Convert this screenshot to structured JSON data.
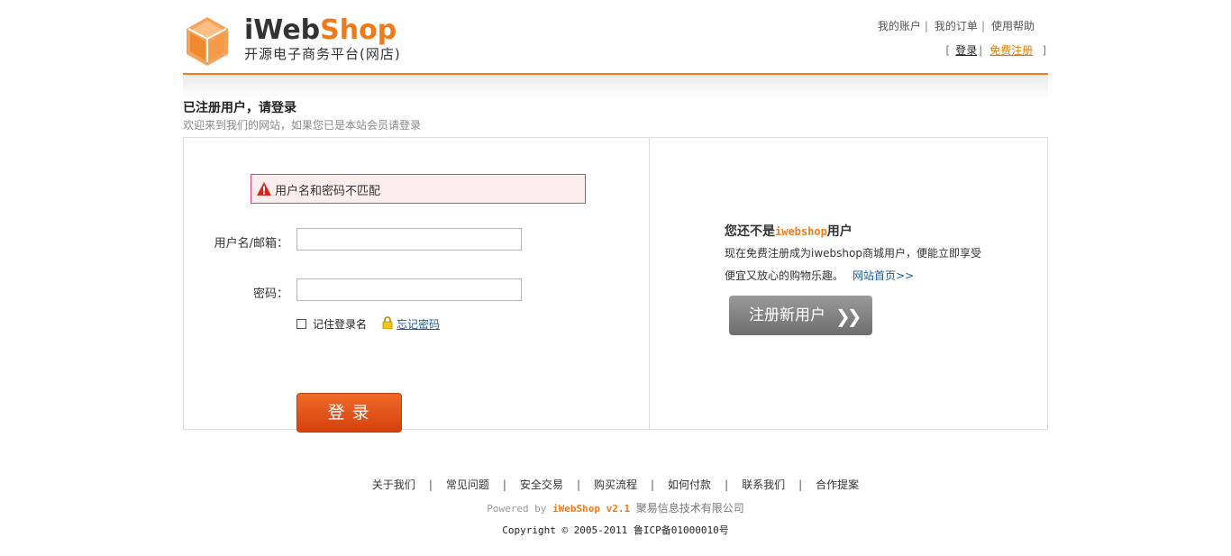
{
  "header": {
    "logo_title_i": "i",
    "logo_title_web": "Web",
    "logo_title_shop": "Shop",
    "logo_subtitle": "开源电子商务平台(网店)",
    "nav": [
      "我的账户",
      "我的订单",
      "使用帮助"
    ],
    "auth": {
      "open_bracket": "[",
      "login": "登录",
      "register": "免费注册",
      "close_bracket": "]"
    },
    "accent_color": "#f07a1a"
  },
  "page": {
    "title": "已注册用户，请登录",
    "subtitle": "欢迎来到我们的网站，如果您已是本站会员请登录"
  },
  "login_form": {
    "error_icon": "warning-icon",
    "error_message": "用户名和密码不匹配",
    "username_label": "用户名/邮箱：",
    "username_value": "",
    "password_label": "密码：",
    "password_value": "",
    "remember_label": "记住登录名",
    "remember_checked": false,
    "forgot_icon": "lock-icon",
    "forgot_label": "忘记密码",
    "submit_label": "登录"
  },
  "register_panel": {
    "title_prefix": "您还不是",
    "title_brand": "iwebshop",
    "title_suffix": "用户",
    "line1": "现在免费注册成为iwebshop商城用户，便能立即享受",
    "line2": "便宜又放心的购物乐趣。",
    "home_link": "网站首页>>",
    "button_label": "注册新用户",
    "button_icon": "double-chevron-right-icon"
  },
  "footer": {
    "links": [
      "关于我们",
      "常见问题",
      "安全交易",
      "购买流程",
      "如何付款",
      "联系我们",
      "合作提案"
    ],
    "powered_prefix": "Powered by",
    "powered_brand": "iWebShop v2.1",
    "company": "聚易信息技术有限公司",
    "copyright": "Copyright © 2005-2011 鲁ICP备01000010号"
  }
}
